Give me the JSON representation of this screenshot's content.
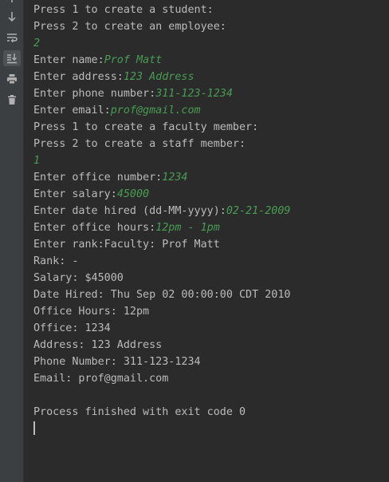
{
  "toolbar": {
    "icons": [
      "arrow-down-icon",
      "soft-wrap-icon",
      "scroll-to-end-icon",
      "print-icon",
      "trash-icon"
    ]
  },
  "colors": {
    "background": "#2b2b2b",
    "gutter": "#3c3f41",
    "output_text": "#bbbbbb",
    "input_text": "#499c54"
  },
  "console": {
    "lines": [
      {
        "text": "Press 1 to create a student:"
      },
      {
        "text": "Press 2 to create an employee:"
      },
      {
        "text": "",
        "input": "2"
      },
      {
        "text": "Enter name:",
        "input": "Prof Matt"
      },
      {
        "text": "Enter address:",
        "input": "123 Address"
      },
      {
        "text": "Enter phone number:",
        "input": "311-123-1234"
      },
      {
        "text": "Enter email:",
        "input": "prof@gmail.com"
      },
      {
        "text": "Press 1 to create a faculty member:"
      },
      {
        "text": "Press 2 to create a staff member:"
      },
      {
        "text": "",
        "input": "1"
      },
      {
        "text": "Enter office number:",
        "input": "1234"
      },
      {
        "text": "Enter salary:",
        "input": "45000"
      },
      {
        "text": "Enter date hired (dd-MM-yyyy):",
        "input": "02-21-2009"
      },
      {
        "text": "Enter office hours:",
        "input": "12pm - 1pm"
      },
      {
        "text": "Enter rank:Faculty: Prof Matt"
      },
      {
        "text": "Rank: -"
      },
      {
        "text": "Salary: $45000"
      },
      {
        "text": "Date Hired: Thu Sep 02 00:00:00 CDT 2010"
      },
      {
        "text": "Office Hours: 12pm"
      },
      {
        "text": "Office: 1234"
      },
      {
        "text": "Address: 123 Address"
      },
      {
        "text": "Phone Number: 311-123-1234"
      },
      {
        "text": "Email: prof@gmail.com"
      },
      {
        "text": ""
      },
      {
        "text": "Process finished with exit code 0"
      }
    ]
  }
}
